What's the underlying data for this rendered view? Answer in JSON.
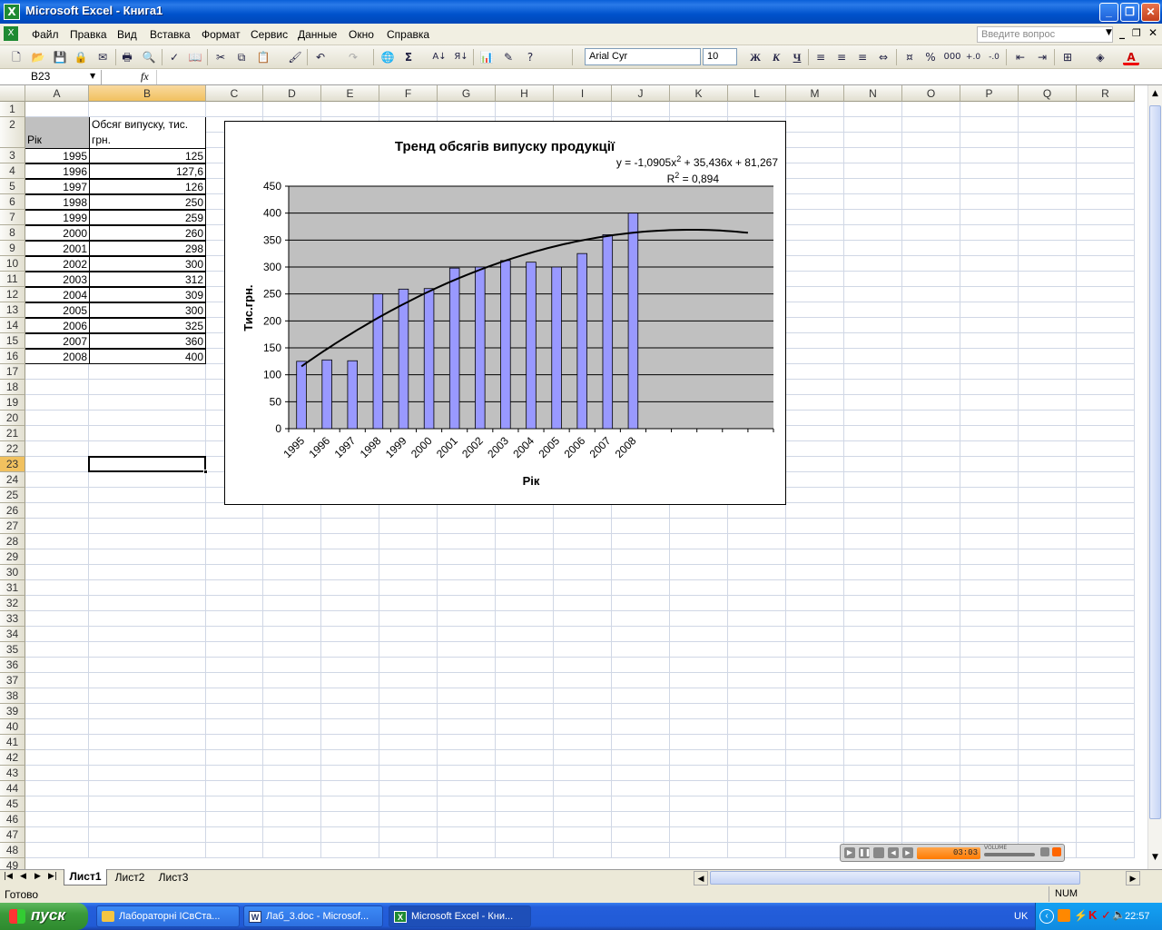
{
  "window": {
    "title": "Microsoft Excel - Книга1",
    "app_icon": "excel-icon"
  },
  "menu": {
    "items": [
      "Файл",
      "Правка",
      "Вид",
      "Вставка",
      "Формат",
      "Сервис",
      "Данные",
      "Окно",
      "Справка"
    ],
    "help_placeholder": "Введите вопрос"
  },
  "toolbar": {
    "font_name": "Arial Cyr",
    "font_size": "10",
    "bold": "Ж",
    "italic": "К",
    "underline": "Ч",
    "percent": "%",
    "thousands": "000",
    "sum": "Σ"
  },
  "formula": {
    "name_box": "B23",
    "fx": "fx",
    "value": ""
  },
  "columns": [
    "A",
    "B",
    "C",
    "D",
    "E",
    "F",
    "G",
    "H",
    "I",
    "J",
    "K",
    "L",
    "M",
    "N",
    "O",
    "P",
    "Q",
    "R"
  ],
  "row_count": 49,
  "selected_row": "23",
  "selected_col": "B",
  "table": {
    "header_a": "Рік",
    "header_b": "Обсяг випуску, тис. грн.",
    "rows": [
      [
        "1995",
        "125"
      ],
      [
        "1996",
        "127,6"
      ],
      [
        "1997",
        "126"
      ],
      [
        "1998",
        "250"
      ],
      [
        "1999",
        "259"
      ],
      [
        "2000",
        "260"
      ],
      [
        "2001",
        "298"
      ],
      [
        "2002",
        "300"
      ],
      [
        "2003",
        "312"
      ],
      [
        "2004",
        "309"
      ],
      [
        "2005",
        "300"
      ],
      [
        "2006",
        "325"
      ],
      [
        "2007",
        "360"
      ],
      [
        "2008",
        "400"
      ]
    ]
  },
  "chart_data": {
    "type": "bar",
    "title": "Тренд обсягів випуску продукції",
    "xlabel": "Рік",
    "ylabel": "Тис.грн.",
    "categories": [
      "1995",
      "1996",
      "1997",
      "1998",
      "1999",
      "2000",
      "2001",
      "2002",
      "2003",
      "2004",
      "2005",
      "2006",
      "2007",
      "2008"
    ],
    "values": [
      125,
      127.6,
      126,
      250,
      259,
      260,
      298,
      300,
      312,
      309,
      300,
      325,
      360,
      400
    ],
    "ylim": [
      0,
      450
    ],
    "yticks": [
      "0",
      "50",
      "100",
      "150",
      "200",
      "250",
      "300",
      "350",
      "400",
      "450"
    ],
    "x_slots": 19,
    "grid": true,
    "trendline": {
      "type": "polynomial",
      "a": -1.0905,
      "b": 35.436,
      "c": 81.267,
      "extend_to_slot": 18.5
    },
    "equation_text": "y = -1,0905x",
    "equation_sup": "2",
    "equation_rest": " + 35,436x + 81,267",
    "r2_prefix": "R",
    "r2_sup": "2",
    "r2_rest": " = 0,894",
    "bar_color": "#9999FF",
    "plot_bg": "#C0C0C0"
  },
  "sheet_tabs": [
    "Лист1",
    "Лист2",
    "Лист3"
  ],
  "status": {
    "left": "Готово",
    "right": "NUM"
  },
  "taskbar": {
    "start": "пуск",
    "tasks": [
      "Лабораторні ІСвСта...",
      "Лаб_3.doc - Microsof...",
      "Microsoft Excel - Кни..."
    ],
    "lang": "UK",
    "time": "22:57"
  },
  "player": {
    "time": "03:03",
    "volume_label": "VOLUME"
  }
}
